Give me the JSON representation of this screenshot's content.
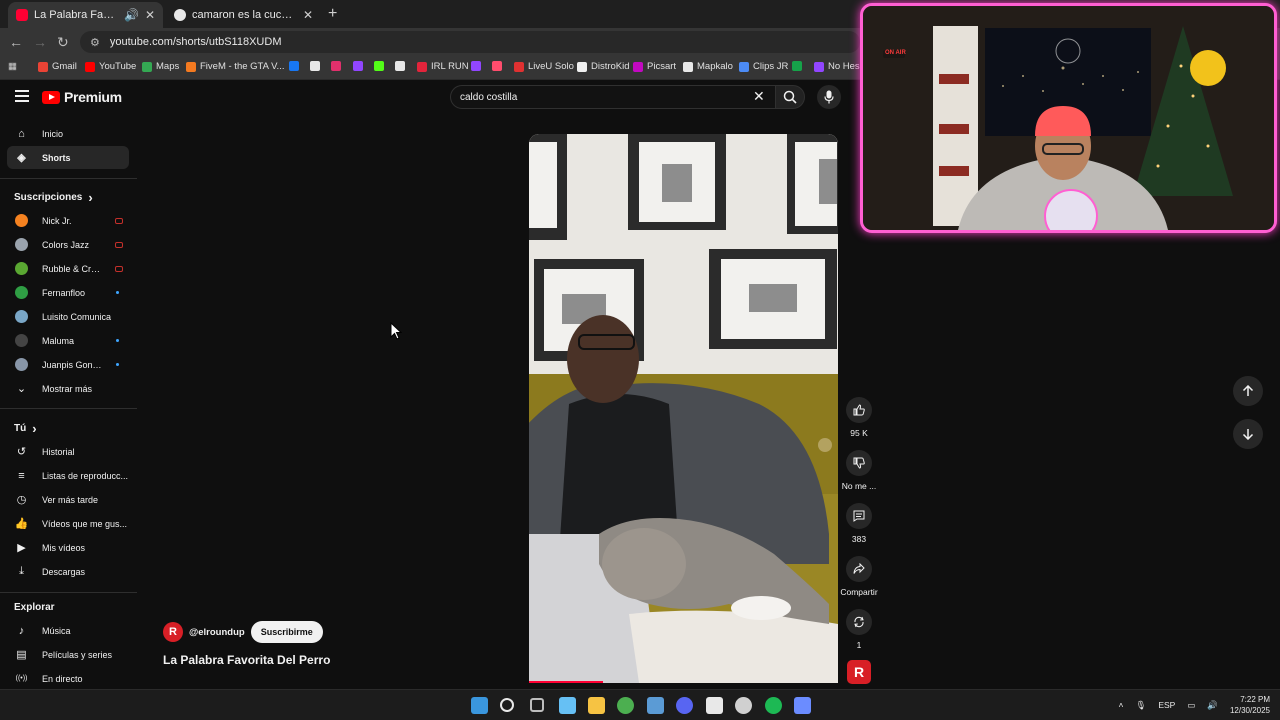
{
  "browser": {
    "tabs": [
      {
        "title": "La Palabra Favorita Del Perro",
        "favicon_color": "#ff0033",
        "active": true
      },
      {
        "title": "camaron es la cucaracha del m",
        "favicon_color": "#e8e8e8",
        "active": false
      }
    ],
    "url": "youtube.com/shorts/utbS118XUDM",
    "bookmarks": [
      {
        "label": "Gmail",
        "color": "#ea4335"
      },
      {
        "label": "YouTube",
        "color": "#ff0000"
      },
      {
        "label": "Maps",
        "color": "#34a853"
      },
      {
        "label": "FiveM - the GTA V...",
        "color": "#f47a20"
      },
      {
        "label": "",
        "color": "#1877f2"
      },
      {
        "label": "",
        "color": "#e8e8e8"
      },
      {
        "label": "",
        "color": "#e1306c"
      },
      {
        "label": "",
        "color": "#9146ff"
      },
      {
        "label": "",
        "color": "#53fc18"
      },
      {
        "label": "",
        "color": "#e8e8e8"
      },
      {
        "label": "IRL RUN",
        "color": "#e3243b"
      },
      {
        "label": "",
        "color": "#9146ff"
      },
      {
        "label": "",
        "color": "#ff4d6d"
      },
      {
        "label": "LiveU Solo",
        "color": "#e03131"
      },
      {
        "label": "DistroKid",
        "color": "#f0f0f0"
      },
      {
        "label": "Picsart",
        "color": "#c209c1"
      },
      {
        "label": "Mapkalo",
        "color": "#e8e8e8"
      },
      {
        "label": "Clips JR",
        "color": "#4c8bf5"
      },
      {
        "label": "",
        "color": "#16a34a"
      },
      {
        "label": "No Hesi",
        "color": "#9146ff"
      }
    ]
  },
  "youtube": {
    "brand": "Premium",
    "search": {
      "value": "caldo costilla"
    },
    "sidebar": {
      "main": [
        {
          "label": "Inicio",
          "icon": "home-icon",
          "glyph": "⌂"
        },
        {
          "label": "Shorts",
          "icon": "shorts-icon",
          "glyph": "◈",
          "active": true
        }
      ],
      "subscriptions_title": "Suscripciones",
      "subscriptions": [
        {
          "label": "Nick Jr.",
          "color": "#f58220",
          "badge": "live"
        },
        {
          "label": "Colors Jazz",
          "color": "#9aa3ad",
          "badge": "live"
        },
        {
          "label": "Rubble & Crew",
          "color": "#5aa832",
          "badge": "live"
        },
        {
          "label": "Fernanfloo",
          "color": "#2f9e44",
          "badge": "dot"
        },
        {
          "label": "Luisito Comunica",
          "color": "#7aa7c7",
          "badge": ""
        },
        {
          "label": "Maluma",
          "color": "#444444",
          "badge": "dot"
        },
        {
          "label": "Juanpis González",
          "color": "#8896a8",
          "badge": "dot"
        }
      ],
      "show_more": "Mostrar más",
      "you_title": "Tú",
      "you": [
        {
          "label": "Historial",
          "icon": "history-icon",
          "glyph": "↺"
        },
        {
          "label": "Listas de reproducc...",
          "icon": "playlists-icon",
          "glyph": "≡"
        },
        {
          "label": "Ver más tarde",
          "icon": "watch-later-icon",
          "glyph": "◷"
        },
        {
          "label": "Vídeos que me gus...",
          "icon": "like-icon",
          "glyph": "👍"
        },
        {
          "label": "Mis vídeos",
          "icon": "my-videos-icon",
          "glyph": "▶"
        },
        {
          "label": "Descargas",
          "icon": "download-icon",
          "glyph": "⤓"
        }
      ],
      "explore_title": "Explorar",
      "explore": [
        {
          "label": "Música",
          "icon": "music-icon",
          "glyph": "♪"
        },
        {
          "label": "Películas y series",
          "icon": "movies-icon",
          "glyph": "▤"
        },
        {
          "label": "En directo",
          "icon": "live-icon",
          "glyph": "((•))"
        }
      ]
    },
    "short": {
      "channel_handle": "@elroundup",
      "channel_initial": "R",
      "subscribe_label": "Suscribirme",
      "title": "La Palabra Favorita Del Perro",
      "progress": 0.24,
      "actions": {
        "likes": "95 K",
        "dislike": "No me ...",
        "comments": "383",
        "share": "Compartir",
        "remix": "1"
      }
    }
  },
  "webcam": {
    "badge": "ON AIR"
  },
  "taskbar": {
    "apps": [
      {
        "name": "windows-start-icon",
        "color": "#3a96dd"
      },
      {
        "name": "search-icon",
        "color": "#e8e8e8"
      },
      {
        "name": "task-view-icon",
        "color": "#bdbdbd"
      },
      {
        "name": "steam-icon",
        "color": "#66c0f4"
      },
      {
        "name": "file-explorer-icon",
        "color": "#f6c343"
      },
      {
        "name": "chrome-icon",
        "color": "#4caf50"
      },
      {
        "name": "store-icon",
        "color": "#5b9bd5"
      },
      {
        "name": "discord-icon",
        "color": "#5865f2"
      },
      {
        "name": "capcut-icon",
        "color": "#e8e8e8"
      },
      {
        "name": "obs-icon",
        "color": "#d0d0d0"
      },
      {
        "name": "spotify-icon",
        "color": "#1db954"
      },
      {
        "name": "app-icon",
        "color": "#6b8cff"
      }
    ],
    "lang": "ESP",
    "time": "7:22 PM",
    "date": "12/30/2025"
  }
}
